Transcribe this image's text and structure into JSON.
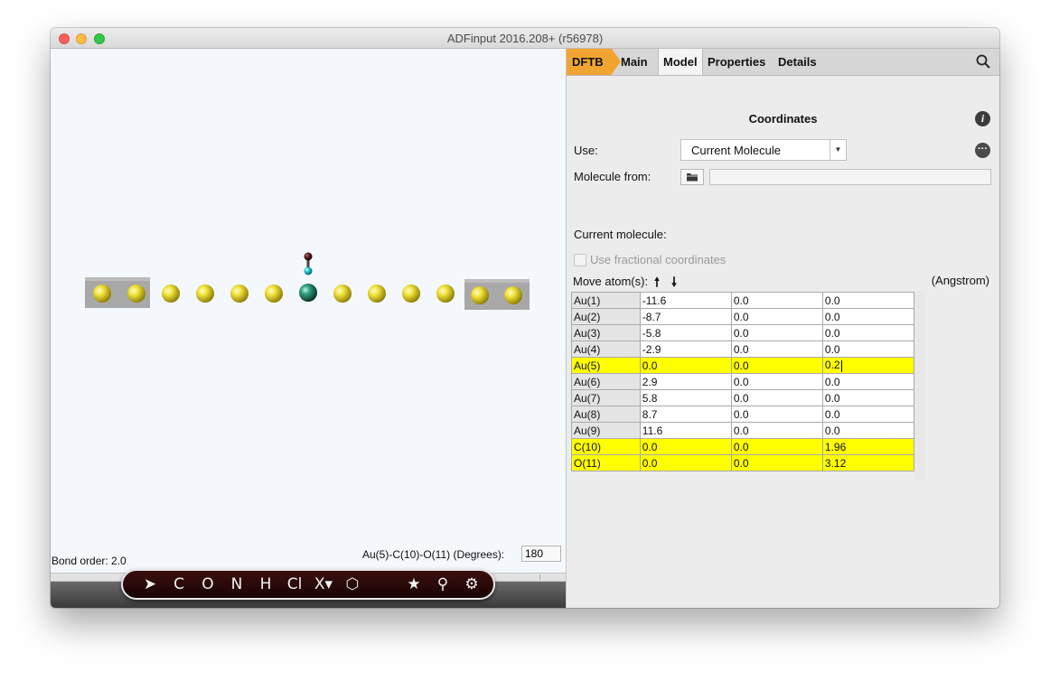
{
  "window": {
    "title": "ADFinput 2016.208+ (r56978)"
  },
  "viewer": {
    "bond_order": "Bond order: 2.0",
    "angle_label": "Au(5)-C(10)-O(11) (Degrees):",
    "angle_value": "180",
    "atom_colors": {
      "gold": "#e3d320",
      "carbon": "#2a2a2a",
      "oxygen": "#6a1f1f",
      "cyan": "#20c5c8"
    }
  },
  "toolbar": {
    "tools": [
      {
        "name": "select-tool",
        "label": "➤"
      },
      {
        "name": "carbon-tool",
        "label": "C"
      },
      {
        "name": "oxygen-tool",
        "label": "O"
      },
      {
        "name": "nitrogen-tool",
        "label": "N"
      },
      {
        "name": "hydrogen-tool",
        "label": "H"
      },
      {
        "name": "chlorine-tool",
        "label": "Cl"
      },
      {
        "name": "element-menu-tool",
        "label": "X▾"
      },
      {
        "name": "ring-tool",
        "label": "⬡"
      },
      {
        "name": "favorites-tool",
        "label": "★"
      },
      {
        "name": "pin-tool",
        "label": "⚲"
      },
      {
        "name": "settings-tool",
        "label": "⚙"
      }
    ]
  },
  "tabs": {
    "engine": "DFTB",
    "items": [
      "Main",
      "Model",
      "Properties",
      "Details"
    ],
    "active": "Model"
  },
  "coordinates": {
    "title": "Coordinates",
    "use_label": "Use:",
    "use_value": "Current Molecule",
    "molecule_from_label": "Molecule from:",
    "molecule_from_value": "",
    "current_molecule_label": "Current molecule:",
    "fractional_label": "Use fractional coordinates",
    "move_atoms_label": "Move atom(s):",
    "move_up": "🠕",
    "move_down": "🠗",
    "unit_label": "(Angstrom)"
  },
  "atoms": [
    {
      "name": "Au(1)",
      "x": "-11.6",
      "y": "0.0",
      "z": "0.0",
      "selected": false
    },
    {
      "name": "Au(2)",
      "x": "-8.7",
      "y": "0.0",
      "z": "0.0",
      "selected": false
    },
    {
      "name": "Au(3)",
      "x": "-5.8",
      "y": "0.0",
      "z": "0.0",
      "selected": false
    },
    {
      "name": "Au(4)",
      "x": "-2.9",
      "y": "0.0",
      "z": "0.0",
      "selected": false
    },
    {
      "name": "Au(5)",
      "x": "0.0",
      "y": "0.0",
      "z": "0.2",
      "selected": true
    },
    {
      "name": "Au(6)",
      "x": "2.9",
      "y": "0.0",
      "z": "0.0",
      "selected": false
    },
    {
      "name": "Au(7)",
      "x": "5.8",
      "y": "0.0",
      "z": "0.0",
      "selected": false
    },
    {
      "name": "Au(8)",
      "x": "8.7",
      "y": "0.0",
      "z": "0.0",
      "selected": false
    },
    {
      "name": "Au(9)",
      "x": "11.6",
      "y": "0.0",
      "z": "0.0",
      "selected": false
    },
    {
      "name": "C(10)",
      "x": "0.0",
      "y": "0.0",
      "z": "1.96",
      "selected": true
    },
    {
      "name": "O(11)",
      "x": "0.0",
      "y": "0.0",
      "z": "3.12",
      "selected": true
    }
  ]
}
